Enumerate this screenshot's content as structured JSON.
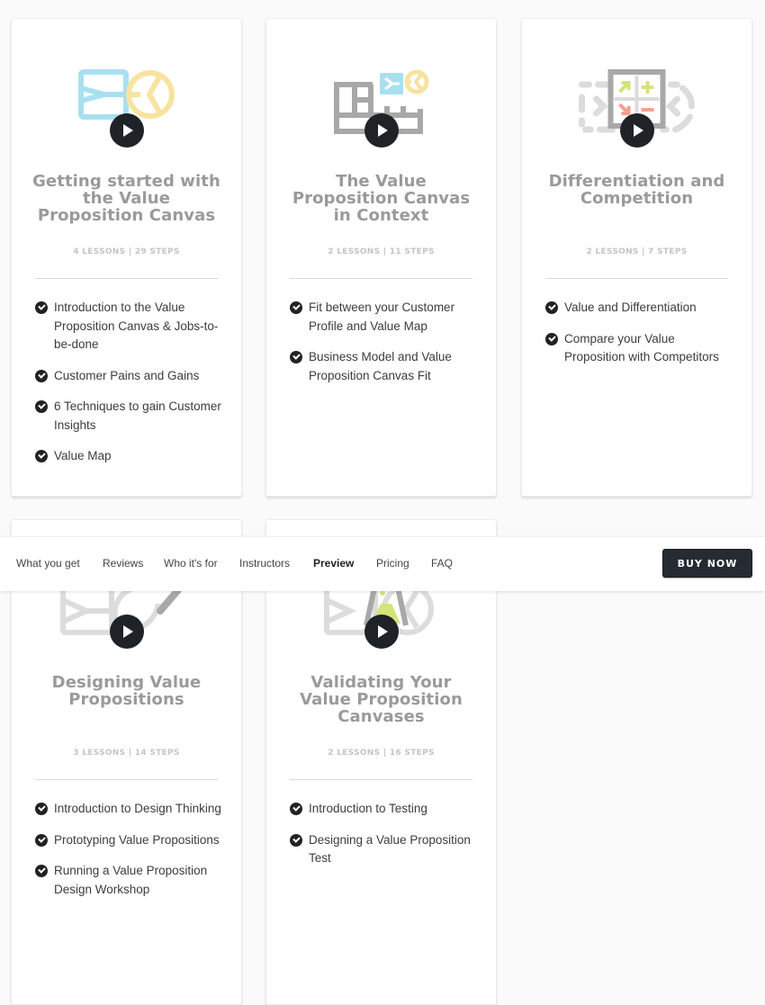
{
  "nav": {
    "items": [
      {
        "label": "What you get",
        "active": false
      },
      {
        "label": "Reviews",
        "active": false
      },
      {
        "label": "Who it's for",
        "active": false
      },
      {
        "label": "Instructors",
        "active": false
      },
      {
        "label": "Preview",
        "active": true
      },
      {
        "label": "Pricing",
        "active": false
      },
      {
        "label": "FAQ",
        "active": false
      }
    ],
    "buy_label": "BUY NOW"
  },
  "colors": {
    "blue": "#a8e0f0",
    "yellow": "#f7e3a0",
    "gray_icon": "#a8a8a8",
    "light_gray_icon": "#dcdcdc",
    "green": "#d4e37a",
    "salmon": "#f2a08f",
    "play": "#1f2327",
    "button": "#262b33"
  },
  "modules": [
    {
      "icon": "canvas-icon",
      "title": "Getting started with the Value Proposition Canvas",
      "meta": "4 LESSONS | 29 STEPS",
      "lessons": [
        "Introduction to the Value Proposition Canvas & Jobs-to-be-done",
        "Customer Pains and Gains",
        "6 Techniques to gain Customer Insights",
        "Value Map"
      ]
    },
    {
      "icon": "business-model-canvas-icon",
      "title": "The Value Proposition Canvas in Context",
      "meta": "2 LESSONS | 11 STEPS",
      "lessons": [
        "Fit between your Customer Profile and Value Map",
        "Business Model and Value Proposition Canvas Fit"
      ]
    },
    {
      "icon": "differentiation-icon",
      "title": "Differentiation and Competition",
      "meta": "2 LESSONS | 7 STEPS",
      "lessons": [
        "Value and Differentiation",
        "Compare your Value Proposition with Competitors"
      ]
    },
    {
      "icon": "design-pen-icon",
      "title": "Designing Value Propositions",
      "meta": "3 LESSONS | 14 STEPS",
      "lessons": [
        "Introduction to Design Thinking",
        "Prototyping Value Propositions",
        "Running a Value Proposition Design Workshop"
      ]
    },
    {
      "icon": "testing-flask-icon",
      "title": "Validating Your Value Proposition Canvases",
      "meta": "2 LESSONS | 16 STEPS",
      "lessons": [
        "Introduction to Testing",
        "Designing a Value Proposition Test"
      ]
    }
  ]
}
